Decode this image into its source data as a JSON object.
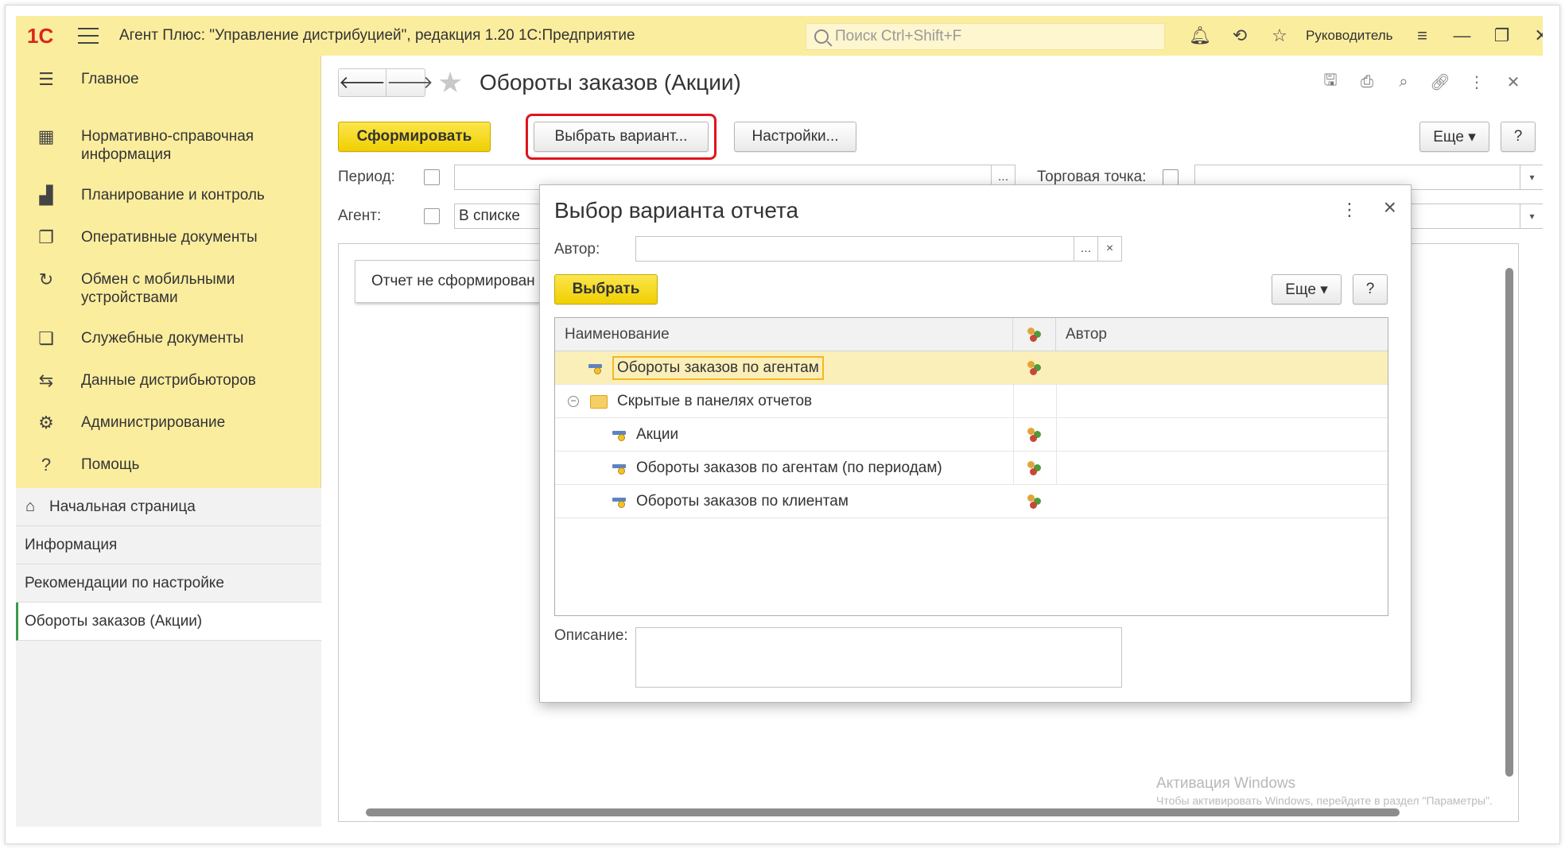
{
  "titlebar": {
    "logo": "1С",
    "title": "Агент Плюс: \"Управление дистрибуцией\", редакция 1.20 1С:Предприятие",
    "search_placeholder": "Поиск Ctrl+Shift+F",
    "user": "Руководитель",
    "icons": [
      "bell-icon",
      "history-icon",
      "star-icon",
      "settings-lines-icon",
      "minimize-icon",
      "restore-icon",
      "close-icon"
    ]
  },
  "sidebar": {
    "items": [
      {
        "icon": "☰",
        "label": "Главное"
      },
      {
        "icon": "▦",
        "label": "Нормативно-справочная информация"
      },
      {
        "icon": "▟",
        "label": "Планирование и контроль"
      },
      {
        "icon": "❐",
        "label": "Оперативные документы"
      },
      {
        "icon": "↻",
        "label": "Обмен с мобильными устройствами"
      },
      {
        "icon": "❏",
        "label": "Служебные документы"
      },
      {
        "icon": "⇆",
        "label": "Данные дистрибьюторов"
      },
      {
        "icon": "⚙",
        "label": "Администрирование"
      },
      {
        "icon": "?",
        "label": "Помощь"
      }
    ],
    "lower": [
      {
        "label": "Начальная страница",
        "icon": "⌂"
      },
      {
        "label": "Информация"
      },
      {
        "label": "Рекомендации по настройке"
      },
      {
        "label": "Обороты заказов (Акции)"
      }
    ]
  },
  "form": {
    "title": "Обороты заказов (Акции)",
    "generate_button": "Сформировать",
    "choose_variant_button": "Выбрать вариант...",
    "settings_button": "Настройки...",
    "more_button": "Еще ▾",
    "help_button": "?",
    "period_label": "Период:",
    "outlet_label": "Торговая точка:",
    "agent_label": "Агент:",
    "agent_value": "В списке",
    "ellipsis": "...",
    "report_message": "Отчет не сформирован",
    "watermark_title": "Активация Windows",
    "watermark_text": "Чтобы активировать Windows, перейдите в раздел \"Параметры\"."
  },
  "dialog": {
    "title": "Выбор варианта отчета",
    "author_label": "Автор:",
    "author_value": "",
    "ellipsis": "...",
    "clear": "×",
    "select_button": "Выбрать",
    "more_button": "Еще ▾",
    "help_button": "?",
    "columns": {
      "name": "Наименование",
      "author": "Автор"
    },
    "rows": [
      {
        "name": "Обороты заказов по агентам",
        "level": 0,
        "type": "variant",
        "selected": true
      },
      {
        "name": "Скрытые в панелях отчетов",
        "level": 0,
        "type": "folder",
        "selected": false
      },
      {
        "name": "Акции",
        "level": 1,
        "type": "variant",
        "selected": false
      },
      {
        "name": "Обороты заказов по агентам (по периодам)",
        "level": 1,
        "type": "variant",
        "selected": false
      },
      {
        "name": "Обороты заказов по клиентам",
        "level": 1,
        "type": "variant",
        "selected": false
      }
    ],
    "description_label": "Описание:"
  }
}
